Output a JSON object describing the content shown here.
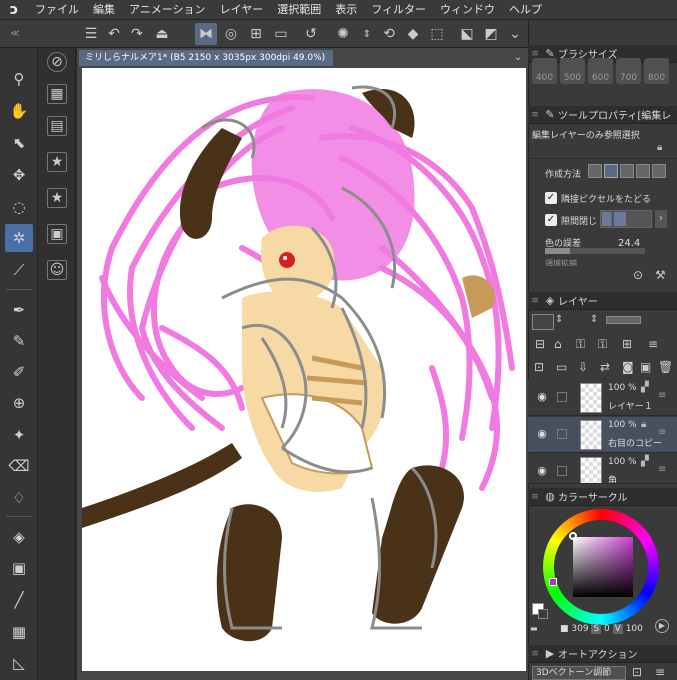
{
  "menu": {
    "items": [
      "ファイル",
      "編集",
      "アニメーション",
      "レイヤー",
      "選択範囲",
      "表示",
      "フィルター",
      "ウィンドウ",
      "ヘルプ"
    ]
  },
  "document": {
    "tab_title": "ミリしらナルメア1* (B5 2150 x 3035px 300dpi 49.0%)"
  },
  "brush_size": {
    "title": "ブラシサイズ",
    "sizes": [
      "400",
      "500",
      "600",
      "700",
      "800"
    ]
  },
  "tool_property": {
    "title": "ツールプロパティ[編集レ",
    "mode": "編集レイヤーのみ参照選択",
    "method_label": "作成方法",
    "follow_adjacent_label": "隣接ピクセルをたどる",
    "close_gap_label": "隙間閉じ",
    "color_margin_label": "色の誤差",
    "color_margin_value": "24.4",
    "area_scale_label": "領域拡縮"
  },
  "layer": {
    "title": "レイヤー",
    "rows": [
      {
        "opacity": "100 %",
        "name": "レイヤー１"
      },
      {
        "opacity": "100 %",
        "name": "右目のコピー"
      },
      {
        "opacity": "100 %",
        "name": "角"
      }
    ]
  },
  "color_wheel": {
    "title": "カラーサークル",
    "h": "309",
    "s_label": "S",
    "s": "0",
    "v_label": "V",
    "v": "100"
  },
  "auto_action": {
    "title": "オートアクション",
    "selected": "3Dベクトーン調節"
  },
  "colors": {
    "hair": "#f07ae0",
    "horn": "#4a3218",
    "skin": "#f6d9a5",
    "sketch": "#8c8c8c",
    "accent": "#4a6fa5"
  }
}
